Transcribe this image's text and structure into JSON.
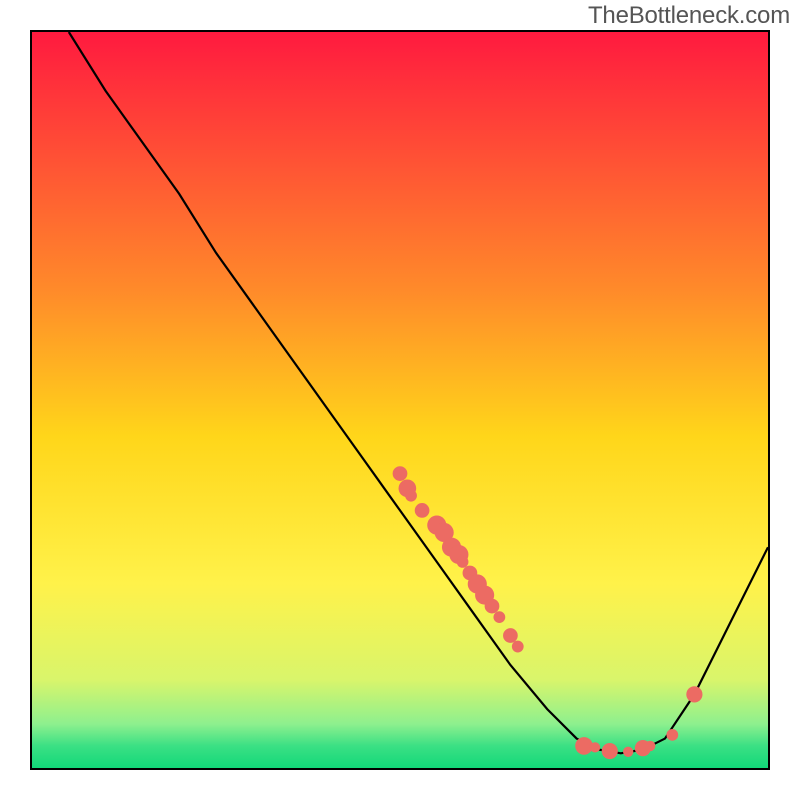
{
  "watermark": "TheBottleneck.com",
  "chart_data": {
    "type": "line",
    "title": "",
    "xlabel": "",
    "ylabel": "",
    "xlim": [
      0,
      100
    ],
    "ylim": [
      0,
      100
    ],
    "curve": [
      {
        "x": 5,
        "y": 100
      },
      {
        "x": 10,
        "y": 92
      },
      {
        "x": 15,
        "y": 85
      },
      {
        "x": 20,
        "y": 78
      },
      {
        "x": 25,
        "y": 70
      },
      {
        "x": 30,
        "y": 63
      },
      {
        "x": 35,
        "y": 56
      },
      {
        "x": 40,
        "y": 49
      },
      {
        "x": 45,
        "y": 42
      },
      {
        "x": 50,
        "y": 35
      },
      {
        "x": 55,
        "y": 28
      },
      {
        "x": 60,
        "y": 21
      },
      {
        "x": 65,
        "y": 14
      },
      {
        "x": 70,
        "y": 8
      },
      {
        "x": 74,
        "y": 4
      },
      {
        "x": 77,
        "y": 2.5
      },
      {
        "x": 80,
        "y": 2
      },
      {
        "x": 83,
        "y": 2.5
      },
      {
        "x": 86,
        "y": 4
      },
      {
        "x": 90,
        "y": 10
      },
      {
        "x": 95,
        "y": 20
      },
      {
        "x": 100,
        "y": 30
      }
    ],
    "points": [
      {
        "x": 50,
        "y": 40,
        "r": 1.0
      },
      {
        "x": 51,
        "y": 38,
        "r": 1.2
      },
      {
        "x": 51.5,
        "y": 37,
        "r": 0.8
      },
      {
        "x": 53,
        "y": 35,
        "r": 1.0
      },
      {
        "x": 55,
        "y": 33,
        "r": 1.3
      },
      {
        "x": 56,
        "y": 32,
        "r": 1.3
      },
      {
        "x": 57,
        "y": 30,
        "r": 1.3
      },
      {
        "x": 58,
        "y": 29,
        "r": 1.3
      },
      {
        "x": 58.5,
        "y": 28,
        "r": 0.8
      },
      {
        "x": 59.5,
        "y": 26.5,
        "r": 1.0
      },
      {
        "x": 60.5,
        "y": 25,
        "r": 1.3
      },
      {
        "x": 61.5,
        "y": 23.5,
        "r": 1.3
      },
      {
        "x": 62.5,
        "y": 22,
        "r": 1.0
      },
      {
        "x": 63.5,
        "y": 20.5,
        "r": 0.8
      },
      {
        "x": 65,
        "y": 18,
        "r": 1.0
      },
      {
        "x": 66,
        "y": 16.5,
        "r": 0.8
      },
      {
        "x": 75,
        "y": 3,
        "r": 1.2
      },
      {
        "x": 76.5,
        "y": 2.8,
        "r": 0.7
      },
      {
        "x": 78.5,
        "y": 2.3,
        "r": 1.1
      },
      {
        "x": 81,
        "y": 2.2,
        "r": 0.7
      },
      {
        "x": 83,
        "y": 2.7,
        "r": 1.1
      },
      {
        "x": 84,
        "y": 3.0,
        "r": 0.7
      },
      {
        "x": 87,
        "y": 4.5,
        "r": 0.8
      },
      {
        "x": 90,
        "y": 10,
        "r": 1.1
      }
    ],
    "gradient_stops": [
      {
        "offset": 0.0,
        "color": "#ff1a3f"
      },
      {
        "offset": 0.35,
        "color": "#ff8a2a"
      },
      {
        "offset": 0.55,
        "color": "#ffd61a"
      },
      {
        "offset": 0.75,
        "color": "#fff24a"
      },
      {
        "offset": 0.88,
        "color": "#d9f56b"
      },
      {
        "offset": 0.94,
        "color": "#8ef08e"
      },
      {
        "offset": 0.97,
        "color": "#3be084"
      },
      {
        "offset": 1.0,
        "color": "#12d879"
      }
    ],
    "point_color": "#ec6b63",
    "line_color": "#000000"
  }
}
